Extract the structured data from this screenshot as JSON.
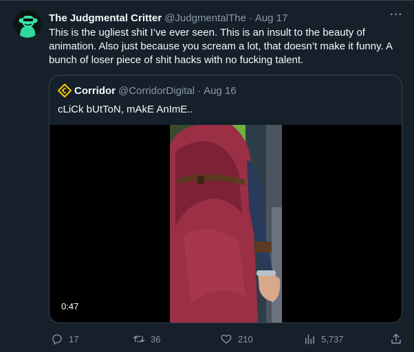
{
  "author": {
    "display_name": "The Judgmental Critter",
    "handle": "@JudgmentalThe",
    "separator": "·",
    "date": "Aug 17",
    "avatar_icon": "ape-avatar-icon"
  },
  "more_label": "···",
  "tweet_text": "This is the ugliest shit I’ve ever seen. This is an insult to the beauty of animation. Also just because you scream a lot, that doesn’t make it funny. A bunch of loser piece of shit hacks with no fucking talent.",
  "quoted": {
    "logo_icon": "corridor-logo-icon",
    "display_name": "Corridor",
    "handle": "@CorridorDigital",
    "separator": "·",
    "date": "Aug 16",
    "text": "cLiCk bUtToN, mAkE AnImE..",
    "video": {
      "duration": "0:47",
      "accent_color": "#1d9bf0"
    }
  },
  "actions": {
    "reply_count": "17",
    "retweet_count": "36",
    "like_count": "210",
    "view_count": "5,737"
  },
  "colors": {
    "background": "#15202b",
    "text": "#f7f9f9",
    "secondary": "#8b98a5",
    "border": "#38444d",
    "corridor_yellow": "#f5c400"
  }
}
